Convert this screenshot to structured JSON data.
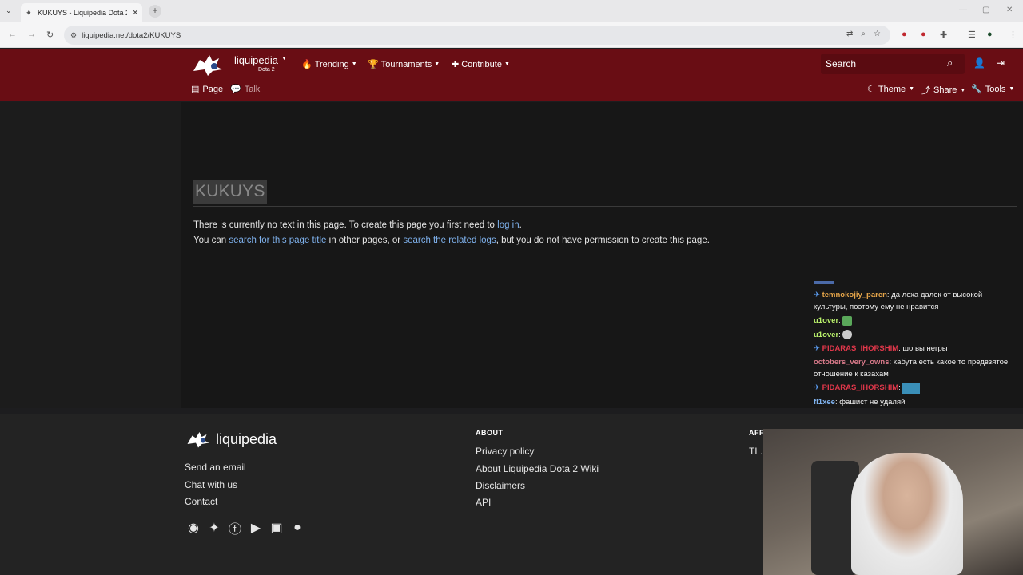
{
  "browser": {
    "tab_title": "KUKUYS - Liquipedia Dota 2 W",
    "tab_close": "✕",
    "new_tab": "+",
    "url": "liquipedia.net/dota2/KUKUYS"
  },
  "site": {
    "brand": "liquipedia",
    "brand_sub": "Dota 2",
    "nav": {
      "trending": "Trending",
      "tournaments": "Tournaments",
      "contribute": "Contribute"
    },
    "search_label": "Search",
    "page_tab": "Page",
    "talk_tab": "Talk",
    "theme": "Theme",
    "share": "Share",
    "tools": "Tools"
  },
  "article": {
    "title": "KUKUYS",
    "line1_pre": "There is currently no text in this page. To create this page you first need to ",
    "line1_link": "log in",
    "line1_post": ".",
    "line2_pre": "You can ",
    "line2_link1": "search for this page title",
    "line2_mid": " in other pages, or ",
    "line2_link2": "search the related logs",
    "line2_post": ", but you do not have permission to create this page."
  },
  "chat": [
    {
      "user": "temnokojiy_paren",
      "text": ": да леха далек от высокой культуры, поэтому ему не нравится"
    },
    {
      "user": "u1over",
      "text": ": "
    },
    {
      "user": "u1over",
      "text": ": "
    },
    {
      "user": "PIDARAS_IHORSHIM",
      "text": ": шо вы негры"
    },
    {
      "user": "octobers_very_owns",
      "text": ": кабута есть какое то предвзятое отношение к казахам"
    },
    {
      "user": "PIDARAS_IHORSHIM",
      "text": ": "
    },
    {
      "user": "fl1xee",
      "text": ": фашист не удаляй"
    }
  ],
  "footer": {
    "brand": "liquipedia",
    "send_email": "Send an email",
    "chat_with_us": "Chat with us",
    "contact": "Contact",
    "about_head": "ABOUT",
    "privacy": "Privacy policy",
    "about_wiki": "About Liquipedia Dota 2 Wiki",
    "disclaimers": "Disclaimers",
    "api": "API",
    "affil_head": "AFFI",
    "affil_link": "TL.n"
  },
  "colors": {
    "brand_bar": "#690d14",
    "link": "#7fb2ee",
    "background": "#171717"
  }
}
